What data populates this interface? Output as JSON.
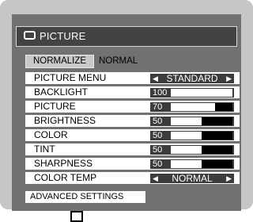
{
  "title": "PICTURE",
  "normalize": {
    "button_label": "NORMALIZE",
    "value": "NORMAL"
  },
  "rows": [
    {
      "label": "PICTURE MENU",
      "type": "selector",
      "value": "STANDARD"
    },
    {
      "label": "BACKLIGHT",
      "type": "slider",
      "value": "100",
      "fill_fraction": 0.0
    },
    {
      "label": "PICTURE",
      "type": "slider",
      "value": "70",
      "fill_fraction": 0.28
    },
    {
      "label": "BRIGHTNESS",
      "type": "slider",
      "value": "50",
      "fill_fraction": 0.5
    },
    {
      "label": "COLOR",
      "type": "slider",
      "value": "50",
      "fill_fraction": 0.5
    },
    {
      "label": "TINT",
      "type": "slider",
      "value": "50",
      "fill_fraction": 0.5
    },
    {
      "label": "SHARPNESS",
      "type": "slider",
      "value": "50",
      "fill_fraction": 0.5
    },
    {
      "label": "COLOR TEMP",
      "type": "selector",
      "value": "NORMAL"
    }
  ],
  "advanced": {
    "label": "ADVANCED SETTINGS"
  },
  "icons": {
    "title": "monitor-icon",
    "arrows": [
      "arrow-left-icon",
      "arrow-right-icon"
    ]
  },
  "colors": {
    "frame": "#c6c6c6",
    "panel": "#717171",
    "title_bar": "#434343",
    "control": "#3c3c3c"
  }
}
